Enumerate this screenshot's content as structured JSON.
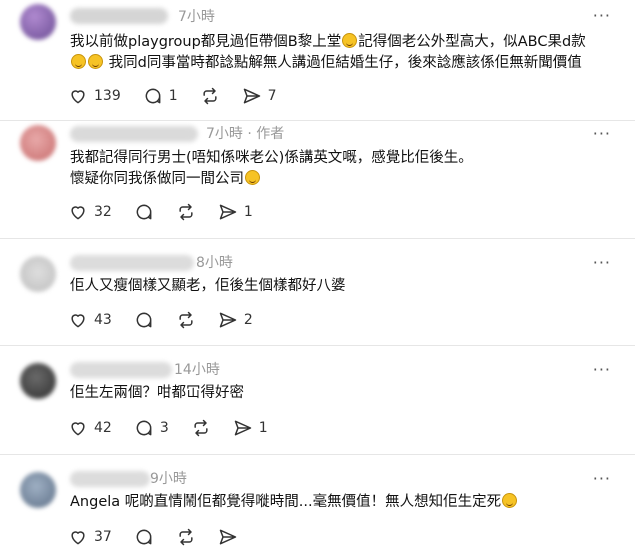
{
  "colors": {
    "text": "#111111",
    "muted": "#999999",
    "divider": "#e6e6e6",
    "icon": "#333333"
  },
  "icons": {
    "like": "heart-icon",
    "comment": "comment-bubble-icon",
    "repost": "repost-icon",
    "share": "send-icon",
    "menu": "more-horizontal-icon"
  },
  "posts": [
    {
      "time": "7小時",
      "author_tag": "",
      "more": "···",
      "lines": [
        {
          "text": "我以前做playgroup都見過佢帶個B黎上堂",
          "emoji": true,
          "tail": "記得個老公外型高大，似ABC果d款"
        },
        {
          "text": "",
          "emoji": true,
          "emoji2": true,
          "tail": "我同d同事當時都諗點解無人講過佢結婚生仔，後來諗應該係佢無新聞價值"
        }
      ],
      "likes": "139",
      "comments": "1",
      "reposts": "",
      "shares": "7"
    },
    {
      "time": "7小時",
      "author_tag": "· 作者",
      "more": "···",
      "lines": [
        {
          "text": "我都記得同行男士(唔知係咪老公)係講英文嘅，感覺比佢後生。",
          "emoji": false,
          "tail": ""
        },
        {
          "text": "懷疑你同我係做同一間公司",
          "emoji": true,
          "tail": ""
        }
      ],
      "likes": "32",
      "comments": "",
      "reposts": "",
      "shares": "1"
    },
    {
      "time": "8小時",
      "author_tag": "",
      "more": "···",
      "lines": [
        {
          "text": "佢人又瘦個樣又顯老，佢後生個樣都好八婆",
          "emoji": false,
          "tail": ""
        }
      ],
      "likes": "43",
      "comments": "",
      "reposts": "",
      "shares": "2"
    },
    {
      "time": "14小時",
      "author_tag": "",
      "more": "···",
      "lines": [
        {
          "text": "佢生左兩個？咁都冚得好密",
          "emoji": false,
          "tail": ""
        }
      ],
      "likes": "42",
      "comments": "3",
      "reposts": "",
      "shares": "1"
    },
    {
      "time": "9小時",
      "author_tag": "",
      "more": "···",
      "lines": [
        {
          "text": "Angela 呢啲直情鬧佢都覺得嘥時間...毫無價值！無人想知佢生定死",
          "emoji": true,
          "tail": ""
        }
      ],
      "likes": "37",
      "comments": "",
      "reposts": "",
      "shares": ""
    }
  ]
}
